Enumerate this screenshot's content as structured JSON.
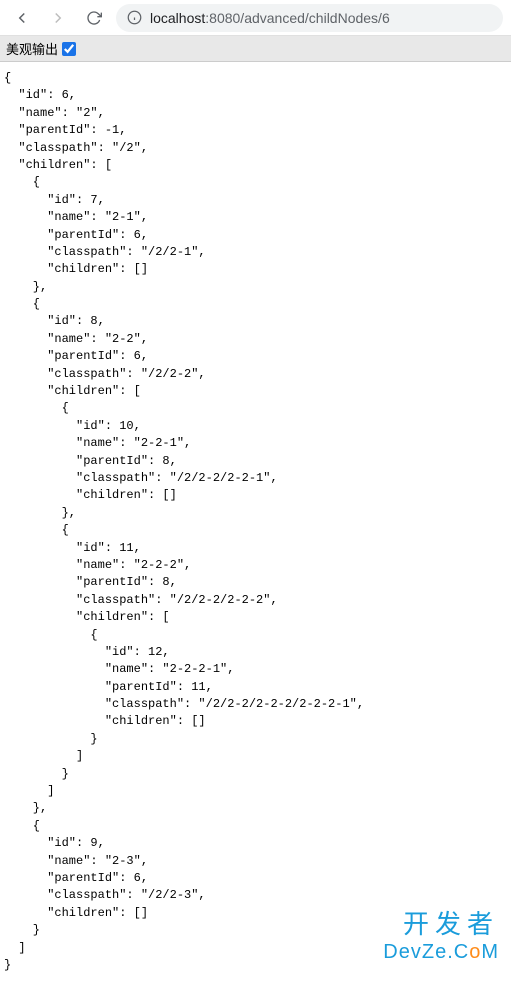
{
  "toolbar": {
    "url_host": "localhost",
    "url_port_path": ":8080/advanced/childNodes/6"
  },
  "pretty": {
    "label": "美观输出",
    "checked": true
  },
  "json_text": "{\n  \"id\": 6,\n  \"name\": \"2\",\n  \"parentId\": -1,\n  \"classpath\": \"/2\",\n  \"children\": [\n    {\n      \"id\": 7,\n      \"name\": \"2-1\",\n      \"parentId\": 6,\n      \"classpath\": \"/2/2-1\",\n      \"children\": []\n    },\n    {\n      \"id\": 8,\n      \"name\": \"2-2\",\n      \"parentId\": 6,\n      \"classpath\": \"/2/2-2\",\n      \"children\": [\n        {\n          \"id\": 10,\n          \"name\": \"2-2-1\",\n          \"parentId\": 8,\n          \"classpath\": \"/2/2-2/2-2-1\",\n          \"children\": []\n        },\n        {\n          \"id\": 11,\n          \"name\": \"2-2-2\",\n          \"parentId\": 8,\n          \"classpath\": \"/2/2-2/2-2-2\",\n          \"children\": [\n            {\n              \"id\": 12,\n              \"name\": \"2-2-2-1\",\n              \"parentId\": 11,\n              \"classpath\": \"/2/2-2/2-2-2/2-2-2-1\",\n              \"children\": []\n            }\n          ]\n        }\n      ]\n    },\n    {\n      \"id\": 9,\n      \"name\": \"2-3\",\n      \"parentId\": 6,\n      \"classpath\": \"/2/2-3\",\n      \"children\": []\n    }\n  ]\n}",
  "watermark": {
    "line1": "开发者",
    "line2_prefix": "DevZe.C",
    "line2_o": "o",
    "line2_suffix": "M"
  }
}
